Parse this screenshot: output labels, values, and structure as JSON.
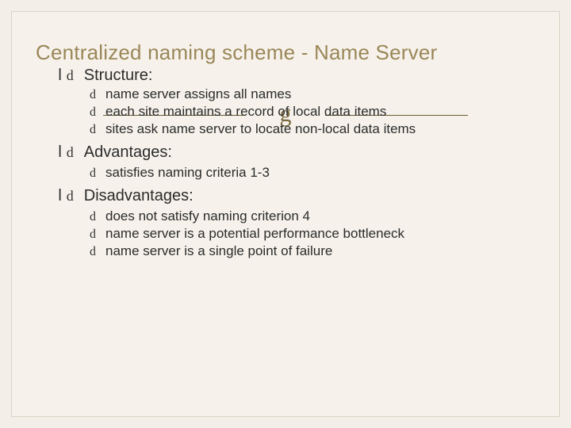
{
  "title": "Centralized naming scheme - Name Server",
  "bullet_glyph": "d",
  "sections": {
    "structure": {
      "label": "Structure:",
      "items": {
        "0": "name server assigns all names",
        "1": "each site maintains a record of local data items",
        "2": "sites ask name server to locate non-local data items"
      }
    },
    "advantages": {
      "label": "Advantages:",
      "items": {
        "0": "satisfies naming criteria 1-3"
      }
    },
    "disadvantages": {
      "label": "Disadvantages:",
      "items": {
        "0": "does not satisfy naming criterion 4",
        "1": "name server is a potential performance bottleneck",
        "2": "name server is a single point of failure"
      }
    }
  }
}
